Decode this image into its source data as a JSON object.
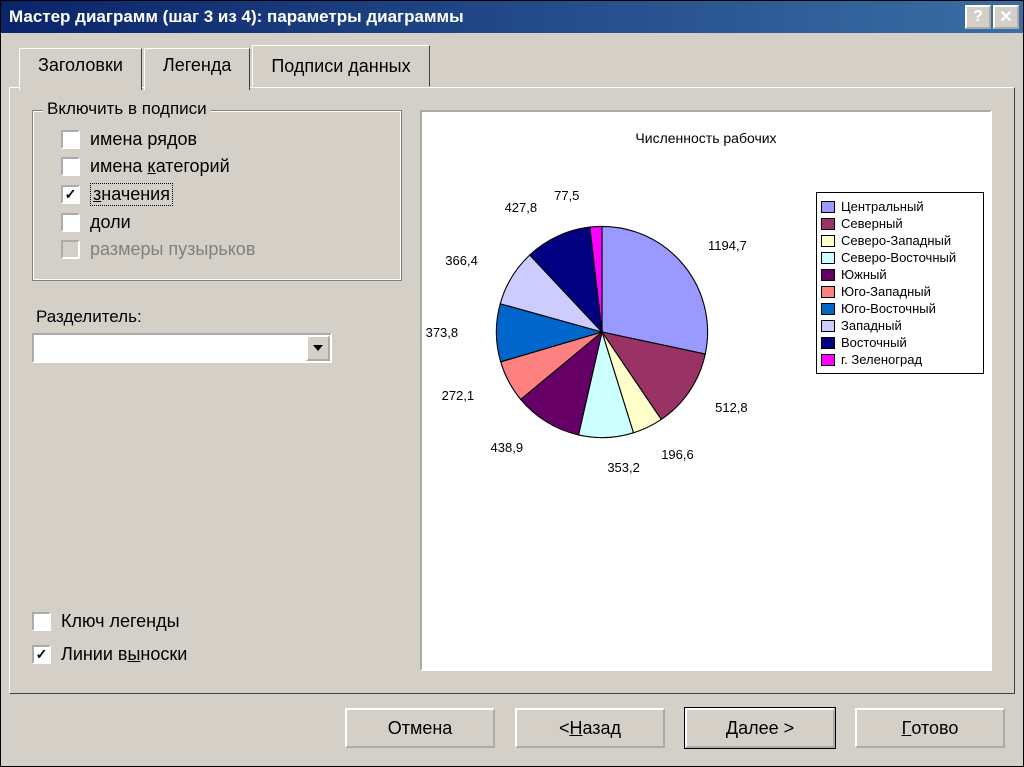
{
  "window": {
    "title": "Мастер диаграмм (шаг 3 из 4): параметры диаграммы"
  },
  "tabs": {
    "headers": "Заголовки",
    "legend": "Легенда",
    "data_labels": "Подписи данных"
  },
  "group": {
    "title": "Включить в подписи",
    "series_names": "имена рядов",
    "category_names_pre": "имена ",
    "category_names_ul": "к",
    "category_names_post": "атегорий",
    "values_ul": "з",
    "values_post": "начения",
    "percent": "доли",
    "bubble": "размеры пузырьков"
  },
  "separator": {
    "label_pre": "Раз",
    "label_ul": "д",
    "label_post": "елитель:",
    "value": ""
  },
  "bottom_checks": {
    "legend_key": "Ключ легенды",
    "leader_pre": "Линии в",
    "leader_ul": "ы",
    "leader_post": "носки"
  },
  "buttons": {
    "cancel": "Отмена",
    "back_pre": "< ",
    "back_ul": "Н",
    "back_post": "азад",
    "next_pre": "",
    "next_ul": "Д",
    "next_post": "алее >",
    "finish_ul": "Г",
    "finish_post": "отово"
  },
  "chart_data": {
    "type": "pie",
    "title": "Численность рабочих",
    "series": [
      {
        "name": "Центральный",
        "value": 1194.7,
        "color": "#9999ff"
      },
      {
        "name": "Северный",
        "value": 512.8,
        "color": "#993366"
      },
      {
        "name": "Северо-Западный",
        "value": 196.6,
        "color": "#ffffcc"
      },
      {
        "name": "Северо-Восточный",
        "value": 353.2,
        "color": "#ccffff"
      },
      {
        "name": "Южный",
        "value": 438.9,
        "color": "#660066"
      },
      {
        "name": "Юго-Западный",
        "value": 272.1,
        "color": "#ff8080"
      },
      {
        "name": "Юго-Восточный",
        "value": 373.8,
        "color": "#0066cc"
      },
      {
        "name": "Западный",
        "value": 366.4,
        "color": "#ccccff"
      },
      {
        "name": "Восточный",
        "value": 427.8,
        "color": "#000080"
      },
      {
        "name": "г. Зеленоград",
        "value": 77.5,
        "color": "#ff00ff"
      }
    ]
  }
}
